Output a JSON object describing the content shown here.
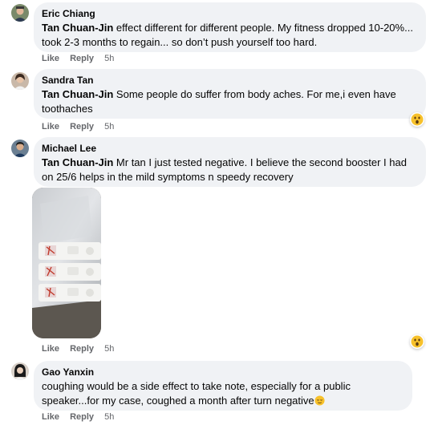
{
  "comments": [
    {
      "author": "Eric Chiang",
      "mention": "Tan Chuan-Jin",
      "text": " effect different for different people. My fitness dropped 10-20%... took 2-3 months to regain... so don’t push yourself too hard.",
      "like": "Like",
      "reply": "Reply",
      "time": "5h"
    },
    {
      "author": "Sandra Tan",
      "mention": "Tan Chuan-Jin",
      "text": " Some people do suffer from body aches. For me,i even have toothaches",
      "like": "Like",
      "reply": "Reply",
      "time": "5h",
      "reaction": "wow-emoji-icon"
    },
    {
      "author": "Michael Lee",
      "mention": "Tan Chuan-Jin",
      "text": " Mr tan I just tested negative. I believe the second booster I had on 25/6 helps in the mild symptoms n speedy recovery",
      "like": "Like",
      "reply": "Reply",
      "time": "5h",
      "reaction": "wow-emoji-icon",
      "attachment": "negative test kits photo"
    },
    {
      "author": "Gao Yanxin",
      "text": "coughing would be a side effect to take note, especially for a public speaker...for my case, coughed a month after turn negative",
      "trailing_emoji": "relieved-face-emoji",
      "like": "Like",
      "reply": "Reply",
      "time": "5h"
    }
  ],
  "colors": {
    "bubble": "#f0f2f5",
    "meta_text": "#65676b",
    "text": "#050505"
  }
}
